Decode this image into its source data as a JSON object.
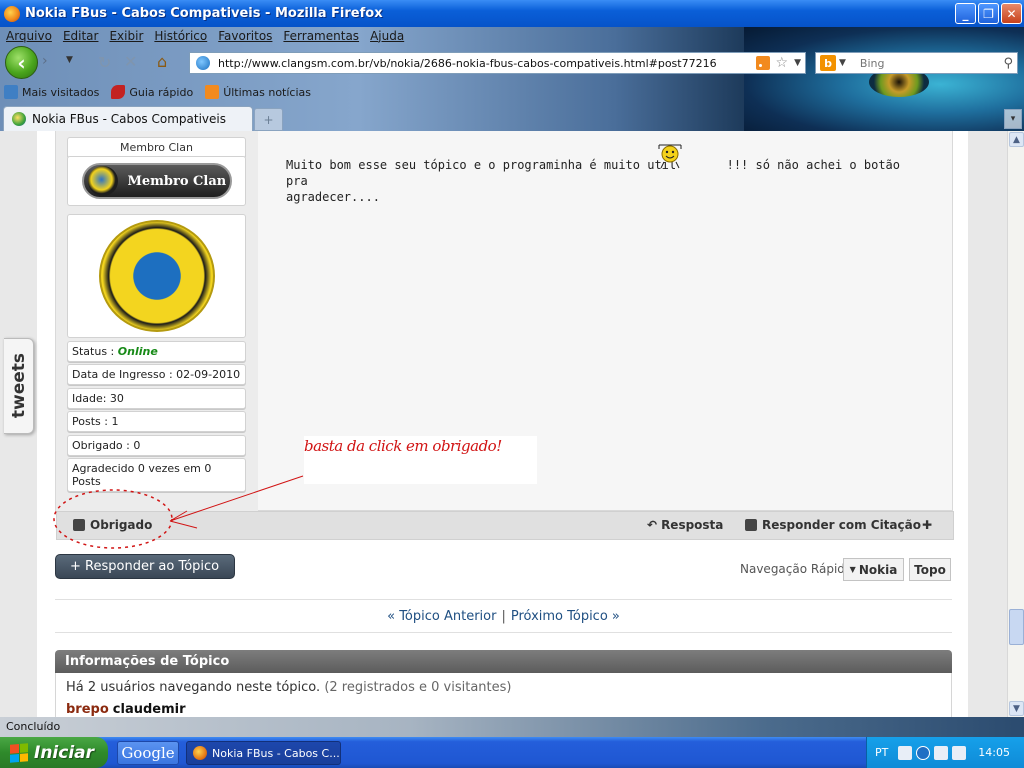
{
  "window": {
    "title": "Nokia FBus - Cabos Compativeis - Mozilla Firefox"
  },
  "menu": {
    "items": [
      "Arquivo",
      "Editar",
      "Exibir",
      "Histórico",
      "Favoritos",
      "Ferramentas",
      "Ajuda"
    ]
  },
  "navbar": {
    "url": "http://www.clangsm.com.br/vb/nokia/2686-nokia-fbus-cabos-compativeis.html#post77216",
    "search_placeholder": "Bing"
  },
  "bookmarks": {
    "items": [
      "Mais visitados",
      "Guia rápido",
      "Últimas notícias"
    ]
  },
  "tabs": {
    "active_label": "Nokia FBus - Cabos Compativeis",
    "new_tab": "+"
  },
  "user": {
    "title": "Membro Clan",
    "rank_badge": "Membro Clan",
    "status_label": "Status : ",
    "status_value": "Online",
    "join_date": "Data de Ingresso : 02-09-2010",
    "age": "Idade: 30",
    "posts": "Posts : 1",
    "thanked": "Obrigado : 0",
    "thanked_received": "Agradecido 0 vezes em 0 Posts"
  },
  "post": {
    "text_line1": "Muito bom esse seu tópico e o programinha é muito util",
    "text_line1_tail": "!!! só não achei o botão pra",
    "text_line2": "agradecer...."
  },
  "annotation": {
    "text": "basta da click em obrigado!"
  },
  "post_footer": {
    "thanks": "Obrigado",
    "reply": "Resposta",
    "reply_quote": "Responder com Citação"
  },
  "actions": {
    "reply_topic": "+ Responder ao Tópico",
    "quicknav_label": "Navegação Rápida",
    "quicknav_value": "Nokia",
    "top": "Topo"
  },
  "topic_nav": {
    "prev": "« Tópico Anterior",
    "separator": "|",
    "next": "Próximo Tópico »"
  },
  "topic_info": {
    "header": "Informações de Tópico",
    "browsing": "Há 2 usuários navegando neste tópico.",
    "browsing_detail": "(2 registrados e 0 visitantes)",
    "user1": "brepo",
    "user2": "claudemir"
  },
  "sidebar_tab": {
    "label": "tweets"
  },
  "statusbar": {
    "text": "Concluído"
  },
  "taskbar": {
    "start": "Iniciar",
    "google": "Google",
    "firefox_task": "Nokia FBus - Cabos C...",
    "lang": "PT",
    "clock": "14:05"
  }
}
